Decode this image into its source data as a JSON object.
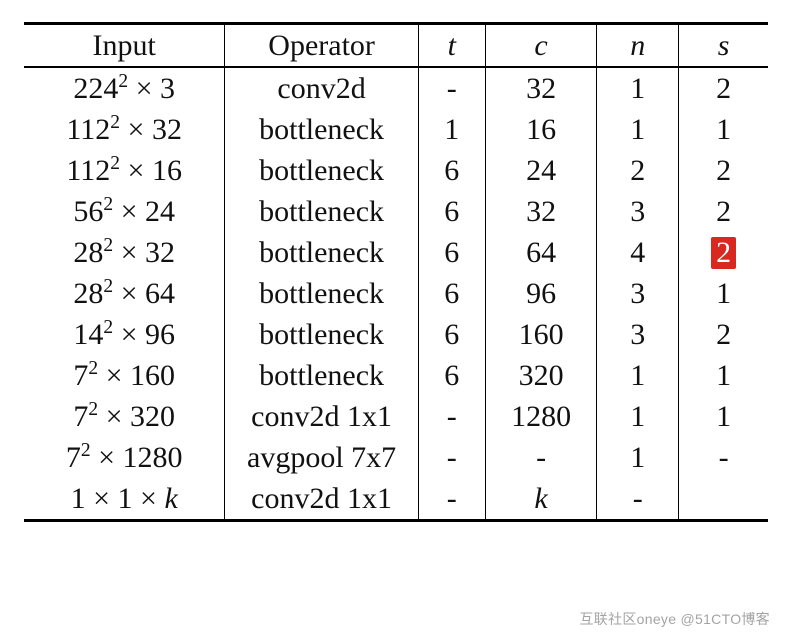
{
  "headers": {
    "input": "Input",
    "operator": "Operator",
    "t": "t",
    "c": "c",
    "n": "n",
    "s": "s"
  },
  "chart_data": {
    "type": "table",
    "columns": [
      "Input",
      "Operator",
      "t",
      "c",
      "n",
      "s"
    ],
    "rows": [
      {
        "input": "224^2 × 3",
        "operator": "conv2d",
        "t": "-",
        "c": "32",
        "n": "1",
        "s": "2"
      },
      {
        "input": "112^2 × 32",
        "operator": "bottleneck",
        "t": "1",
        "c": "16",
        "n": "1",
        "s": "1"
      },
      {
        "input": "112^2 × 16",
        "operator": "bottleneck",
        "t": "6",
        "c": "24",
        "n": "2",
        "s": "2"
      },
      {
        "input": "56^2 × 24",
        "operator": "bottleneck",
        "t": "6",
        "c": "32",
        "n": "3",
        "s": "2"
      },
      {
        "input": "28^2 × 32",
        "operator": "bottleneck",
        "t": "6",
        "c": "64",
        "n": "4",
        "s": "2",
        "s_highlight": true
      },
      {
        "input": "28^2 × 64",
        "operator": "bottleneck",
        "t": "6",
        "c": "96",
        "n": "3",
        "s": "1"
      },
      {
        "input": "14^2 × 96",
        "operator": "bottleneck",
        "t": "6",
        "c": "160",
        "n": "3",
        "s": "2"
      },
      {
        "input": "7^2 × 160",
        "operator": "bottleneck",
        "t": "6",
        "c": "320",
        "n": "1",
        "s": "1"
      },
      {
        "input": "7^2 × 320",
        "operator": "conv2d 1x1",
        "t": "-",
        "c": "1280",
        "n": "1",
        "s": "1"
      },
      {
        "input": "7^2 × 1280",
        "operator": "avgpool 7x7",
        "t": "-",
        "c": "-",
        "n": "1",
        "s": "-"
      },
      {
        "input": "1 × 1 × k",
        "operator": "conv2d 1x1",
        "t": "-",
        "c": "k",
        "n": "-",
        "s": ""
      }
    ]
  },
  "watermark": "互联社区oneye @51CTO博客"
}
